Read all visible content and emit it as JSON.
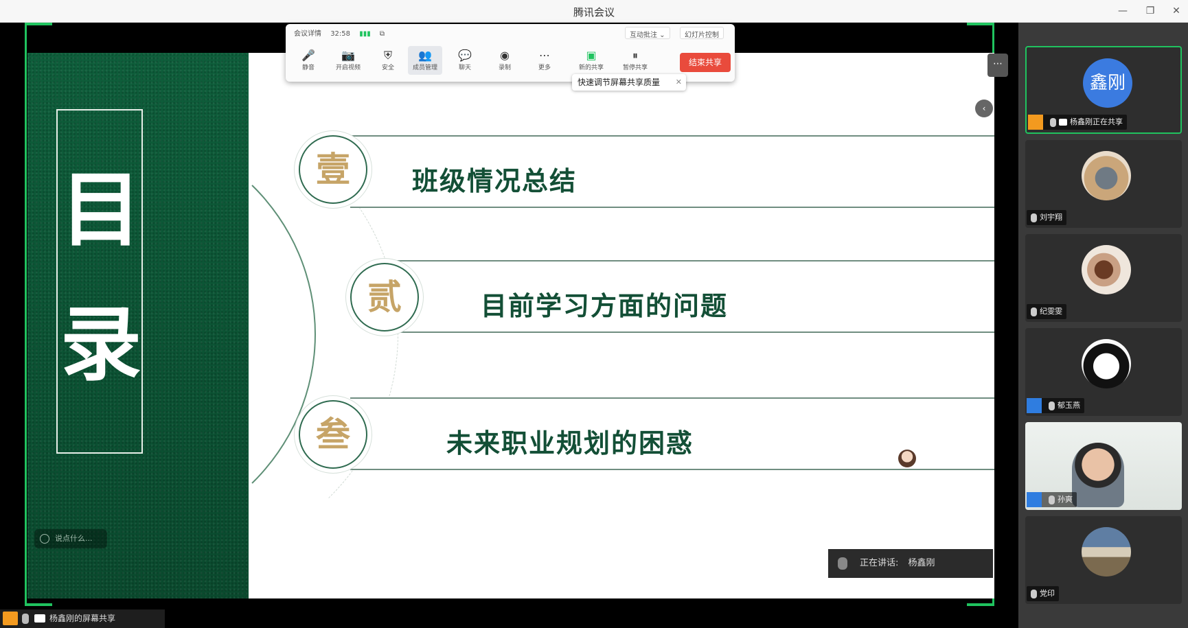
{
  "window": {
    "title": "腾讯会议"
  },
  "toolbar": {
    "top_left": [
      "会议详情",
      "32:58"
    ],
    "right_btn1": "互动批注",
    "right_btn2": "幻灯片控制",
    "tools": [
      {
        "icon": "microphone-icon",
        "label": "静音"
      },
      {
        "icon": "camera-icon",
        "label": "开启视频"
      },
      {
        "icon": "shield-icon",
        "label": "安全"
      },
      {
        "icon": "participants-icon",
        "label": "成员管理"
      },
      {
        "icon": "chat-icon",
        "label": "聊天"
      },
      {
        "icon": "record-icon",
        "label": "录制"
      },
      {
        "icon": "more-icon",
        "label": "更多"
      },
      {
        "icon": "new-share-icon",
        "label": "新的共享"
      },
      {
        "icon": "pause-share-icon",
        "label": "暂停共享"
      }
    ],
    "stop_share": "结束共享",
    "tip": "快速调节屏幕共享质量"
  },
  "slide": {
    "title_chars": [
      "目",
      "录"
    ],
    "search_pill": "说点什么...",
    "items": [
      {
        "badge": "壹",
        "text": "班级情况总结"
      },
      {
        "badge": "贰",
        "text": "目前学习方面的问题"
      },
      {
        "badge": "叁",
        "text": "未来职业规划的困惑"
      }
    ]
  },
  "speaking": {
    "label": "正在讲话:",
    "name": "杨鑫刚"
  },
  "share_status": "杨鑫刚的屏幕共享",
  "participants": [
    {
      "avatar_text": "鑫刚",
      "name": "杨鑫刚正在共享",
      "role": "host",
      "sharing": true,
      "active": true
    },
    {
      "name": "刘宇翔",
      "role": "none"
    },
    {
      "name": "纪雯雯",
      "role": "none"
    },
    {
      "name": "郁玉燕",
      "role": "cohost"
    },
    {
      "name": "孙爽",
      "role": "cohost",
      "video": true
    },
    {
      "name": "党印",
      "role": "none"
    }
  ],
  "colors": {
    "share_frame": "#20c35f",
    "slide_green": "#0e5e3b",
    "badge_gold": "#c6a467",
    "stop_red": "#e94b3c"
  }
}
